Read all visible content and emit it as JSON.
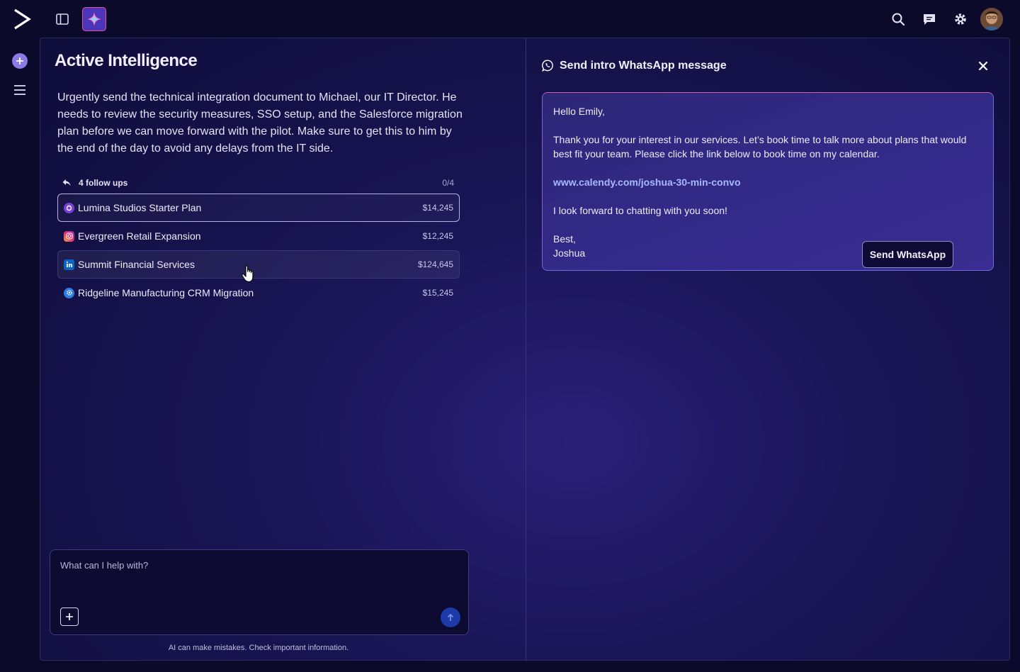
{
  "colors": {
    "accent": "#4b35b8",
    "accent_border": "#e0529e",
    "background": "#0b0a2a",
    "send": "#1c3aa8"
  },
  "topbar": {
    "logo": "chevron-logo",
    "icons": [
      "panel-toggle-icon",
      "sparkle-icon",
      "search-icon",
      "message-icon",
      "gear-icon",
      "avatar"
    ]
  },
  "page": {
    "title": "Active Intelligence",
    "prompt": "Urgently send the technical integration document to Michael, our IT Director. He needs to review the security measures, SSO setup, and the Salesforce migration plan before we can move forward with the pilot. Make sure to get this to him by the end of the day to avoid any delays from the IT side."
  },
  "followups": {
    "label": "4 follow ups",
    "count": "0/4",
    "items": [
      {
        "name": "Lumina Studios Starter Plan",
        "amount": "$14,245",
        "icon": "lumina-icon"
      },
      {
        "name": "Evergreen Retail Expansion",
        "amount": "$12,245",
        "icon": "instagram-icon"
      },
      {
        "name": "Summit Financial Services",
        "amount": "$124,645",
        "icon": "linkedin-icon"
      },
      {
        "name": "Ridgeline Manufacturing CRM Migration",
        "amount": "$15,245",
        "icon": "gear-badge-icon"
      }
    ]
  },
  "chat": {
    "placeholder": "What can I help with?",
    "disclaimer": "AI can make mistakes. Check important information."
  },
  "panel": {
    "title": "Send intro WhatsApp message",
    "message": {
      "greeting": "Hello Emily,",
      "body": "Thank you for your interest in our services. Let’s book time to talk more about plans that would best fit your team. Please click the link below to book time on my calendar.",
      "link": "www.calendy.com/joshua-30-min-convo",
      "closing": "I look forward to chatting with you soon!",
      "signoff": "Best,",
      "signature": "Joshua"
    },
    "send_label": "Send WhatsApp"
  }
}
